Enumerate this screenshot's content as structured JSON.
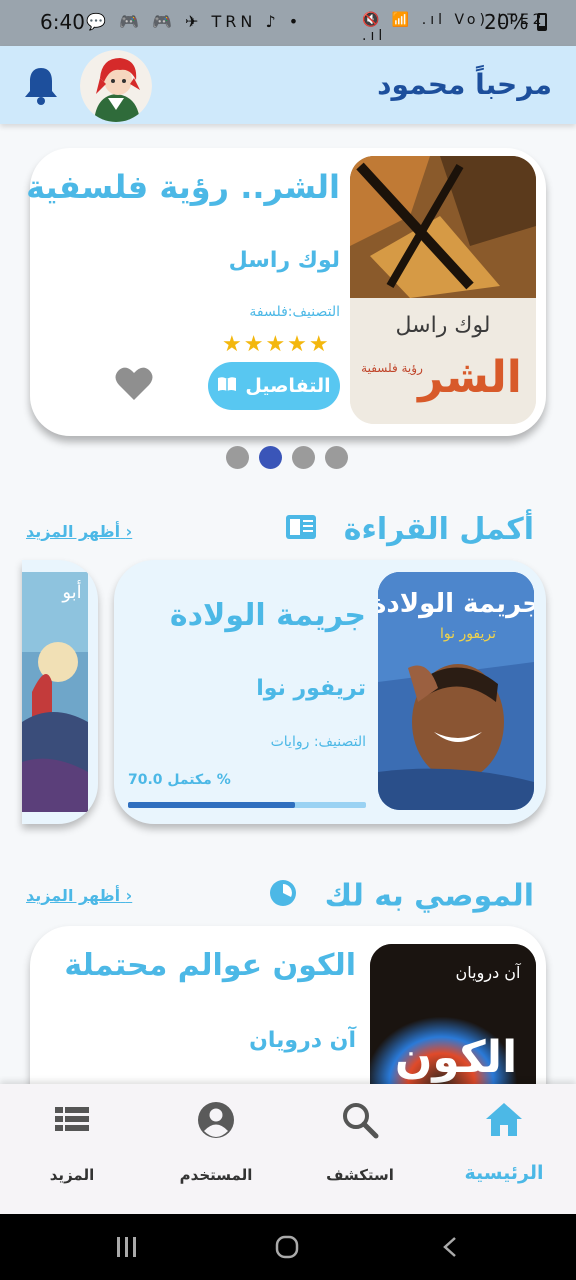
{
  "status_bar": {
    "time": "6:40",
    "battery": "20%",
    "left_icons": "💬 🎮 🎮 ✈ TRN ♪ •",
    "right_icons": "🔇 📶 .ıl Vo) LTE2 .ıl"
  },
  "header": {
    "greeting": "مرحباً محمود"
  },
  "featured": {
    "title": "الشر.. رؤية فلسفية",
    "author": "لوك راسل",
    "category": "التصنيف:فلسفة",
    "stars": "★★★★★",
    "details_label": "التفاصيل",
    "cover_author": "لوك راسل",
    "cover_title": "الشر",
    "cover_subtitle": "رؤية فلسفية"
  },
  "carousel": {
    "count": 4,
    "active": 1
  },
  "continue_reading": {
    "section_title": "أكمل القراءة",
    "see_more": "أظهر المزيد",
    "title": "جريمة الولادة",
    "author": "تريفور نوا",
    "category": "التصنيف: روايات",
    "progress_label": "مكتمل 70.0 %",
    "progress": 0.7,
    "cover_title": "جريمة الولادة",
    "cover_author": "تريفور نوا",
    "next_partial": "أبو"
  },
  "recommended": {
    "section_title": "الموصي به لك",
    "see_more": "أظهر المزيد",
    "title": "الكون عوالم محتملة",
    "author": "آن درويان",
    "cover_author": "آن درويان",
    "cover_title": "الكون"
  },
  "bottom_nav": {
    "home": "الرئيسية",
    "explore": "استكشف",
    "user": "المستخدم",
    "more": "المزيد"
  },
  "colors": {
    "accent": "#4cb8e6",
    "header_bg": "#cfe9fb",
    "dark_blue": "#1d4f9c",
    "star": "#f3b70e"
  }
}
